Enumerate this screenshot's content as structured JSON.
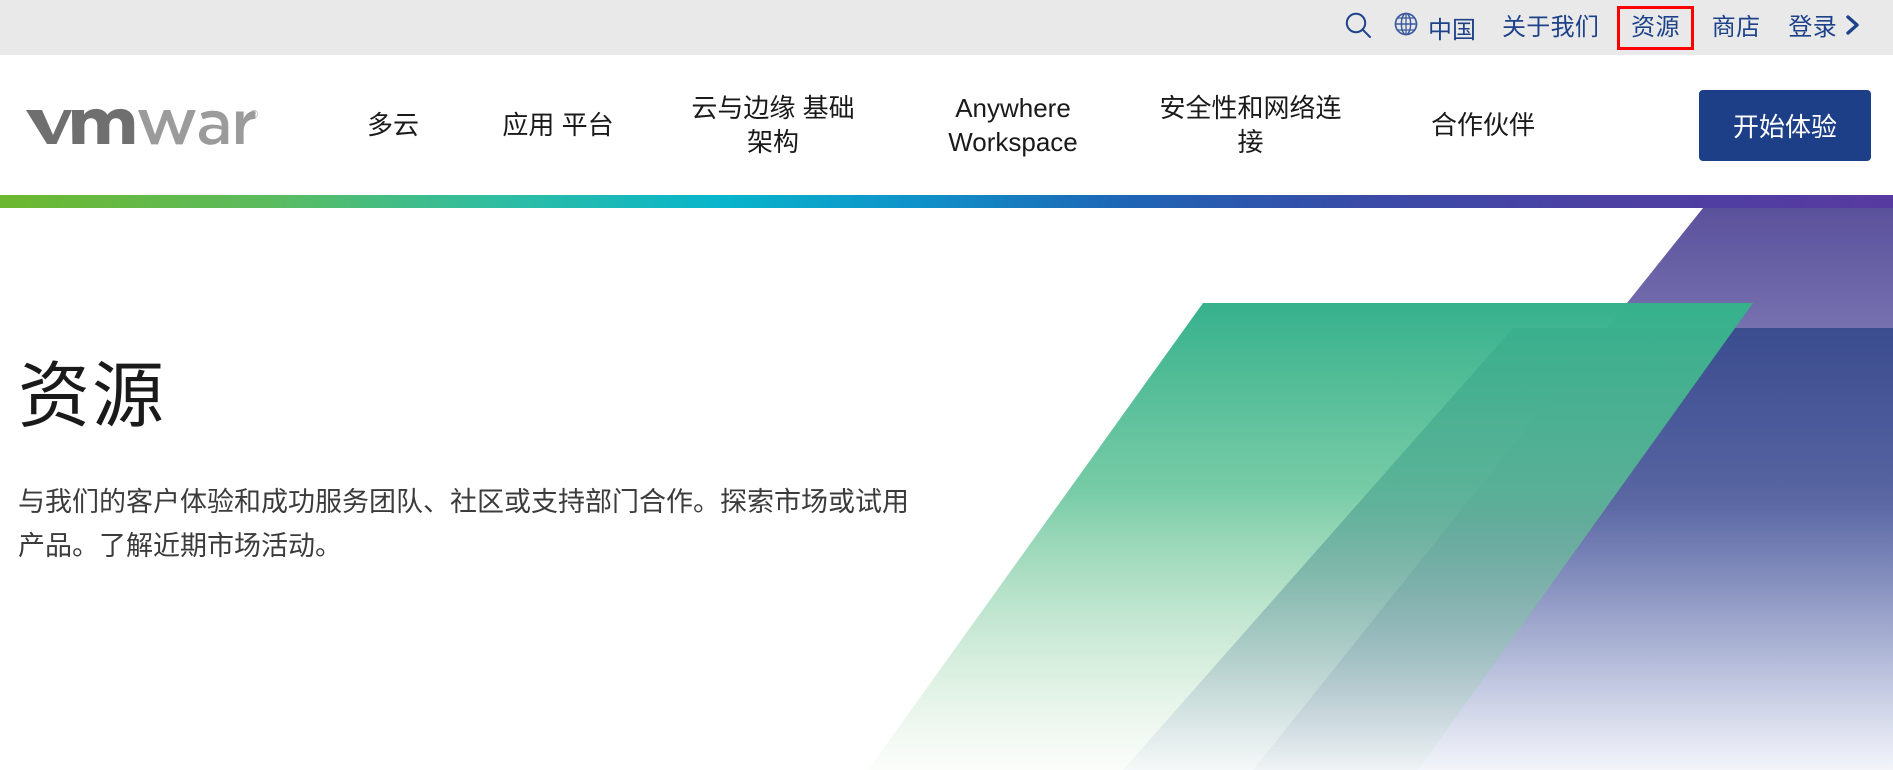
{
  "utility_bar": {
    "search_icon": "search-icon",
    "globe_icon": "globe-icon",
    "region_label": "中国",
    "links": [
      {
        "label": "关于我们",
        "highlighted": false
      },
      {
        "label": "资源",
        "highlighted": true
      },
      {
        "label": "商店",
        "highlighted": false
      }
    ],
    "login_label": "登录",
    "login_chevron": "chevron-right-icon",
    "highlight_color": "#ff0000",
    "link_color": "#1d428a",
    "background_color": "#e9e9e9"
  },
  "main_nav": {
    "logo_text": "vmware",
    "logo_registered_mark": "®",
    "items": [
      {
        "label": "多云"
      },
      {
        "label": "应用 平台"
      },
      {
        "label": "云与边缘 基础\n架构"
      },
      {
        "label": "Anywhere\nWorkspace"
      },
      {
        "label": "安全性和网络连\n接"
      },
      {
        "label": "合作伙伴"
      }
    ],
    "cta_label": "开始体验",
    "cta_color": "#1d3f87"
  },
  "gradient_rule": {
    "stops": [
      "#6cb72e",
      "#30bda0",
      "#08b5cb",
      "#1f63b4",
      "#573aa0"
    ]
  },
  "hero": {
    "title": "资源",
    "description": "与我们的客户体验和成功服务团队、社区或支持部门合作。探索市场或试用产品。了解近期市场活动。",
    "art": {
      "band_green": "#35b18c",
      "band_blue": "#3b4d8f",
      "band_purple": "#5a519c"
    }
  }
}
